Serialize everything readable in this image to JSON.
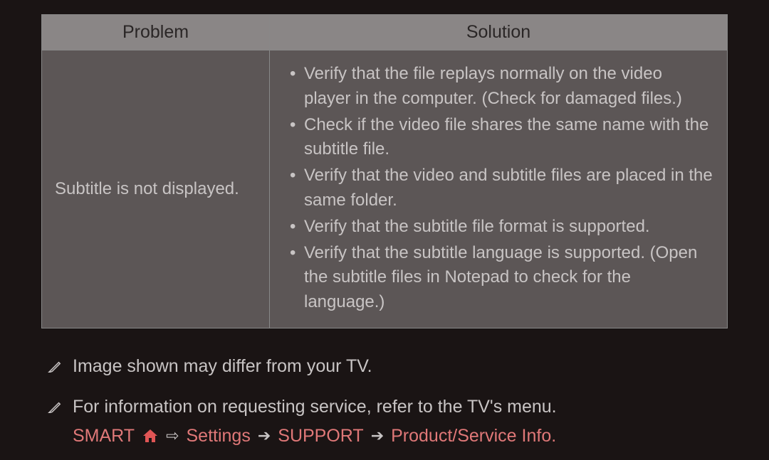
{
  "table": {
    "headers": {
      "problem": "Problem",
      "solution": "Solution"
    },
    "row": {
      "problem": "Subtitle is not displayed.",
      "solutions": [
        "Verify that the file replays normally on the video player in the computer. (Check for damaged files.)",
        "Check if the video file shares the same name with the subtitle file.",
        "Verify that the video and subtitle files are placed in the same folder.",
        "Verify that the subtitle file format is supported.",
        "Verify that the subtitle language is supported. (Open the subtitle files in Notepad to check for the language.)"
      ]
    }
  },
  "notes": [
    "Image shown may differ from your TV.",
    "For information on requesting service, refer to the TV's menu."
  ],
  "nav": {
    "smart": "SMART",
    "arrow1": "⇨",
    "settings": "Settings",
    "arrow2": "➔",
    "support": "SUPPORT",
    "arrow3": "➔",
    "product": "Product/Service Info."
  }
}
